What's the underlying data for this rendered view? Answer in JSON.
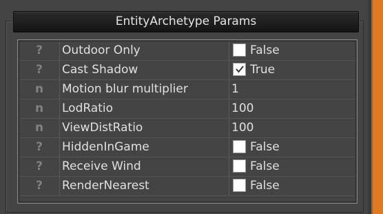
{
  "panel": {
    "title": "EntityArchetype Params"
  },
  "colors": {
    "panel_bg": "#444444",
    "header_bg": "#1e1e1e",
    "text": "#e0e0e0",
    "type_marker": "#828282",
    "accent": "#e07a1e"
  },
  "properties": [
    {
      "type_marker": "?",
      "type_icon": "bool-type-icon",
      "name": "Outdoor Only",
      "kind": "checkbox",
      "checked": false,
      "value": "False"
    },
    {
      "type_marker": "?",
      "type_icon": "bool-type-icon",
      "name": "Cast Shadow",
      "kind": "checkbox",
      "checked": true,
      "value": "True"
    },
    {
      "type_marker": "n",
      "type_icon": "number-type-icon",
      "name": "Motion blur multiplier",
      "kind": "number",
      "value": "1"
    },
    {
      "type_marker": "n",
      "type_icon": "number-type-icon",
      "name": "LodRatio",
      "kind": "number",
      "value": "100"
    },
    {
      "type_marker": "n",
      "type_icon": "number-type-icon",
      "name": "ViewDistRatio",
      "kind": "number",
      "value": "100"
    },
    {
      "type_marker": "?",
      "type_icon": "bool-type-icon",
      "name": "HiddenInGame",
      "kind": "checkbox",
      "checked": false,
      "value": "False"
    },
    {
      "type_marker": "?",
      "type_icon": "bool-type-icon",
      "name": "Receive Wind",
      "kind": "checkbox",
      "checked": false,
      "value": "False"
    },
    {
      "type_marker": "?",
      "type_icon": "bool-type-icon",
      "name": "RenderNearest",
      "kind": "checkbox",
      "checked": false,
      "value": "False"
    }
  ]
}
